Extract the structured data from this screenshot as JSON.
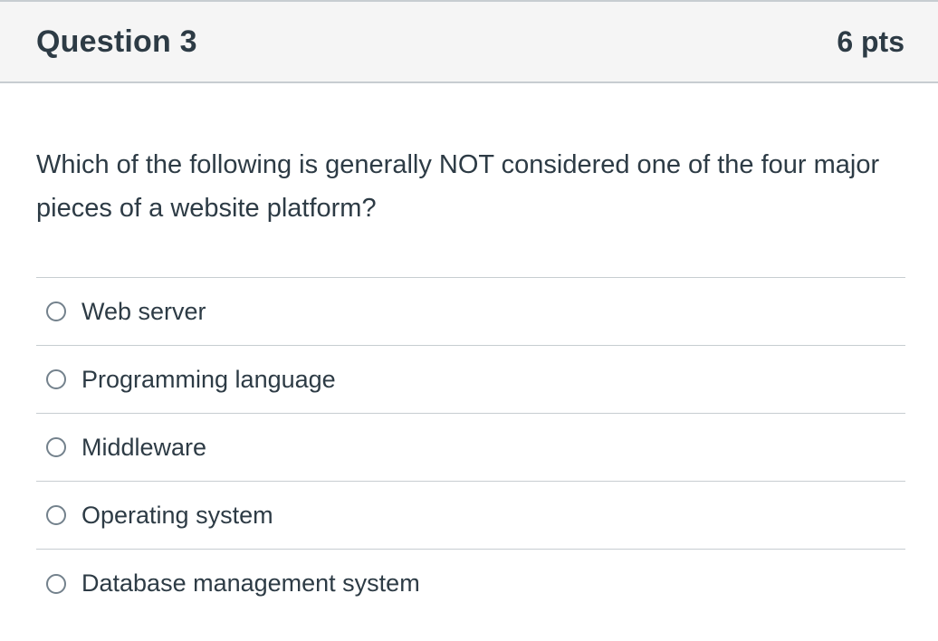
{
  "question": {
    "title": "Question 3",
    "points": "6 pts",
    "text": "Which of the following is generally NOT considered one of the four major pieces of a website platform?"
  },
  "answers": [
    {
      "label": "Web server",
      "icon": "radio-unchecked-icon"
    },
    {
      "label": "Programming language",
      "icon": "radio-unchecked-icon"
    },
    {
      "label": "Middleware",
      "icon": "radio-unchecked-icon"
    },
    {
      "label": "Operating system",
      "icon": "radio-unchecked-icon"
    },
    {
      "label": "Database management system",
      "icon": "radio-unchecked-icon"
    }
  ],
  "colors": {
    "text": "#2d3b45",
    "header_bg": "#f5f5f5",
    "border": "#c7cdd1",
    "radio_border": "#73818c"
  }
}
